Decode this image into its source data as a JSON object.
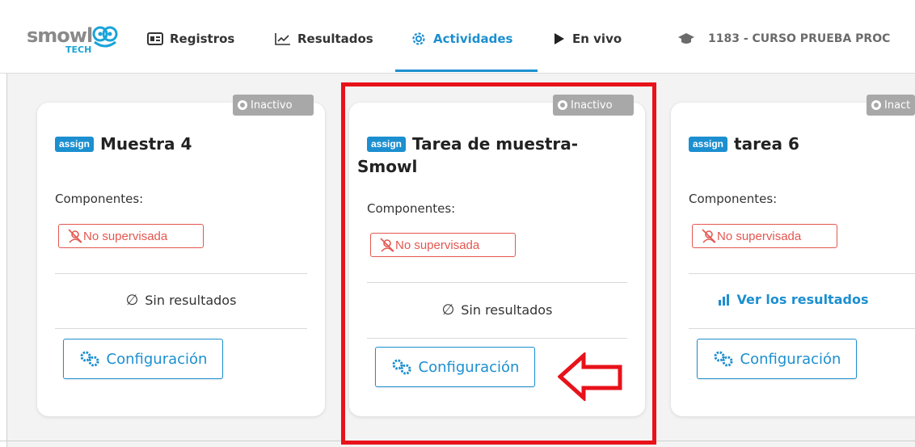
{
  "brand": {
    "logo_text": "smowl",
    "logo_sub": "TECH"
  },
  "nav": {
    "items": [
      {
        "label": "Registros",
        "icon": "id-card-icon",
        "active": false
      },
      {
        "label": "Resultados",
        "icon": "chart-line-icon",
        "active": false
      },
      {
        "label": "Actividades",
        "icon": "gear-icon",
        "active": true
      },
      {
        "label": "En vivo",
        "icon": "play-icon",
        "active": false
      }
    ],
    "course": "1183 - CURSO PRUEBA PROC",
    "course_icon": "graduation-cap-icon",
    "accent_color": "#1c8fd0"
  },
  "cards": [
    {
      "status": "Inactivo",
      "type_badge": "assign",
      "title": "Muestra 4",
      "components_label": "Componentes:",
      "supervision": "No supervisada",
      "results": "Sin resultados",
      "config_label": "Configuración"
    },
    {
      "status": "Inactivo",
      "type_badge": "assign",
      "title_line1": "Tarea de muestra-",
      "title_line2": "Smowl",
      "components_label": "Componentes:",
      "supervision": "No supervisada",
      "results": "Sin resultados",
      "config_label": "Configuración"
    },
    {
      "status": "Inact",
      "type_badge": "assign",
      "title": "tarea 6",
      "components_label": "Componentes:",
      "supervision": "No supervisada",
      "results": "Ver los resultados",
      "config_label": "Configuración"
    }
  ],
  "colors": {
    "status_bg": "#a8a8a8",
    "warning_red": "#e4574f",
    "highlight_red": "#e8121a"
  }
}
